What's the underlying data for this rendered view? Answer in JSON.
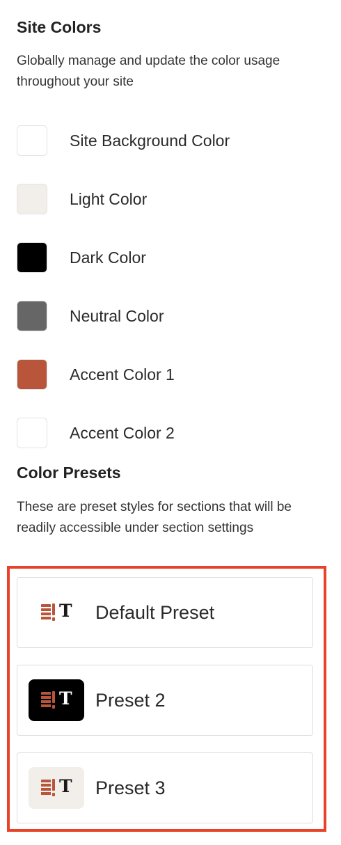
{
  "site_colors": {
    "title": "Site Colors",
    "description": "Globally manage and update the color usage throughout your site",
    "items": [
      {
        "label": "Site Background Color",
        "color": "#ffffff"
      },
      {
        "label": "Light Color",
        "color": "#f2eeea"
      },
      {
        "label": "Dark Color",
        "color": "#000000"
      },
      {
        "label": "Neutral Color",
        "color": "#666666"
      },
      {
        "label": "Accent Color 1",
        "color": "#b8553a"
      },
      {
        "label": "Accent Color 2",
        "color": "#ffffff"
      }
    ]
  },
  "color_presets": {
    "title": "Color Presets",
    "description": "These are preset styles for sections that will be readily accessible under section settings",
    "highlight_color": "#e8432a",
    "items": [
      {
        "label": "Default Preset",
        "thumb_bg": "#ffffff",
        "thumb_text_color": "#1a1a1a",
        "thumb_glyph": "T",
        "icon": "preset-style-icon"
      },
      {
        "label": "Preset 2",
        "thumb_bg": "#000000",
        "thumb_text_color": "#ffffff",
        "thumb_glyph": "T",
        "icon": "preset-style-icon"
      },
      {
        "label": "Preset 3",
        "thumb_bg": "#f2eeea",
        "thumb_text_color": "#1a1a1a",
        "thumb_glyph": "T",
        "icon": "preset-style-icon"
      }
    ]
  }
}
